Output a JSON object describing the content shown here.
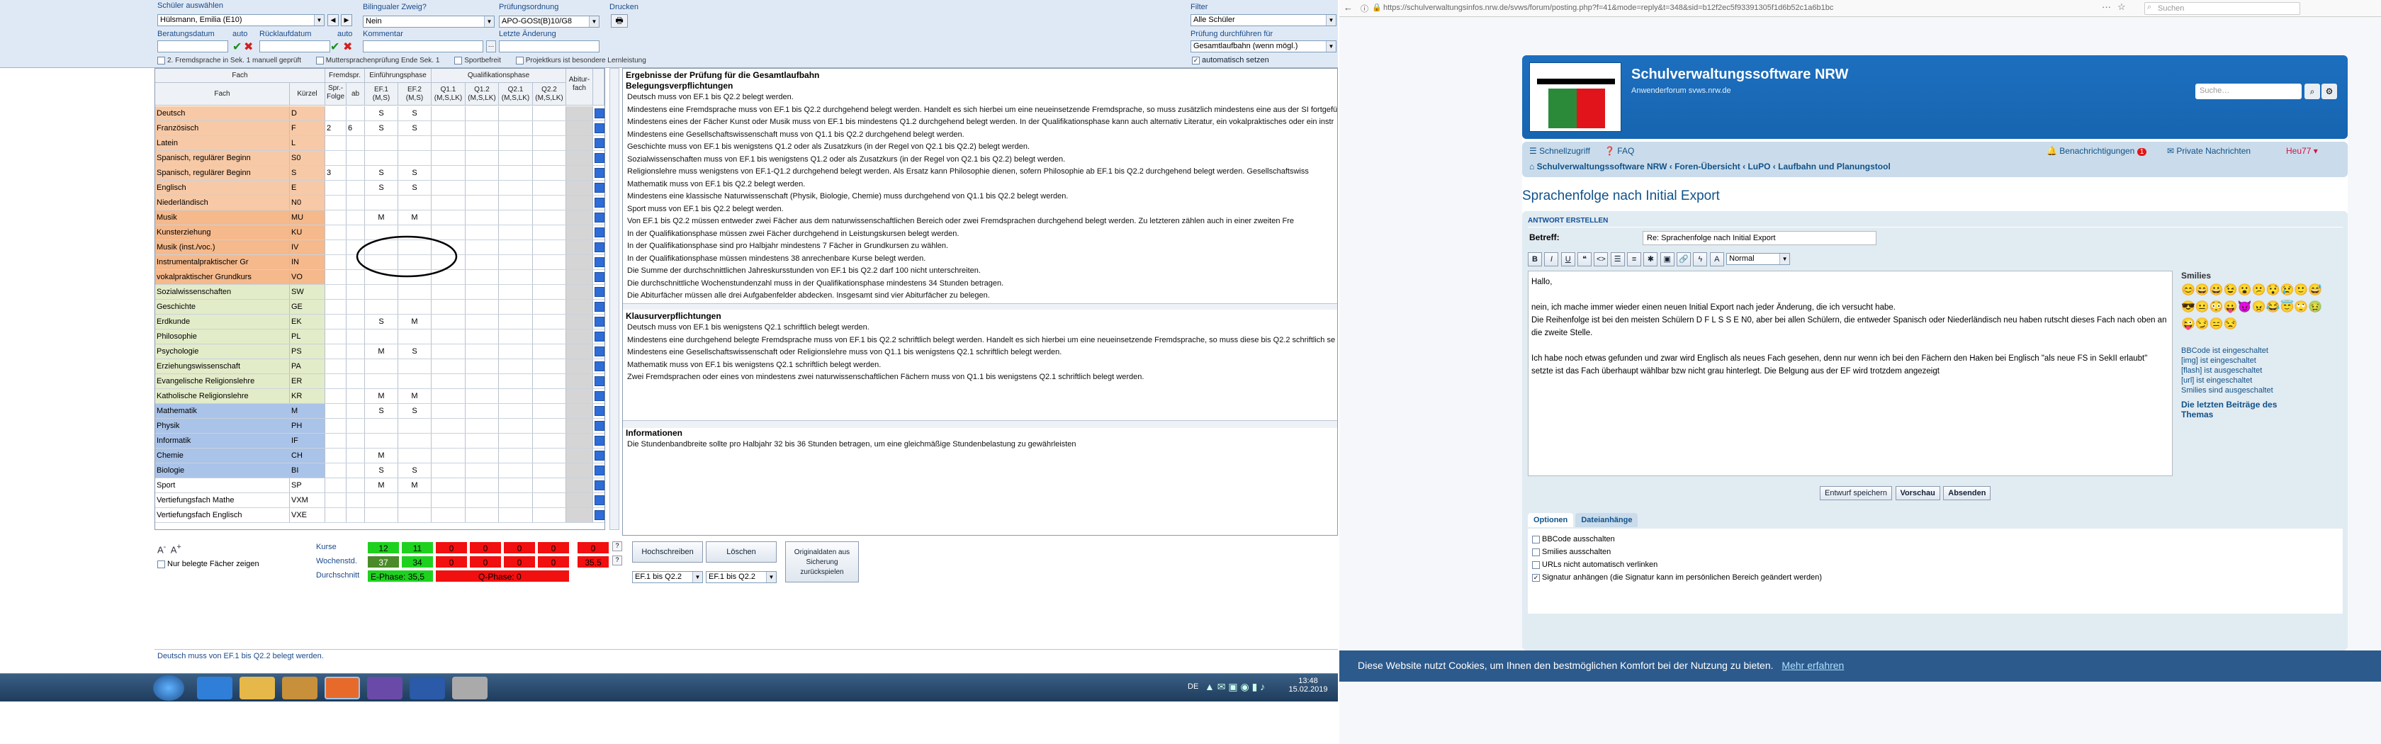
{
  "left": {
    "schueler": {
      "label": "Schüler auswählen",
      "value": "Hülsmann, Emilia (E10)"
    },
    "bili": {
      "label": "Bilingualer Zweig?",
      "value": "Nein"
    },
    "pruefo": {
      "label": "Prüfungsordnung",
      "value": "APO-GOSt(B)10/G8"
    },
    "drucken": {
      "label": "Drucken"
    },
    "beratungsdatum": "Beratungsdatum",
    "auto1": "auto",
    "rueckl": "Rücklaufdatum",
    "auto2": "auto",
    "kommentar": "Kommentar",
    "letzte": "Letzte Änderung",
    "filter": {
      "label": "Filter",
      "value": "Alle Schüler"
    },
    "pruefung": {
      "label": "Prüfung durchführen für",
      "value": "Gesamtlaufbahn (wenn mögl.)",
      "auto": "automatisch setzen"
    },
    "checks": [
      "2. Fremdsprache in Sek. 1 manuell geprüft",
      "Muttersprachenprüfung Ende Sek. 1",
      "Sportbefreit",
      "Projektkurs ist besondere Lernleistung"
    ],
    "grid": {
      "headers": {
        "fach": "Fach",
        "fremdsp": "Fremdspr.",
        "einf": "Einführungsphase",
        "quali": "Qualifikationsphase",
        "abi": "Abitur-fach",
        "fach2": "Fach",
        "kuerzel": "Kürzel",
        "spr": "Spr.-Folge",
        "abjg": "ab Jg.",
        "ef1": "EF.1 (M,S)",
        "ef2": "EF.2 (M,S)",
        "q11": "Q1.1 (M,S,LK)",
        "q12": "Q1.2 (M,S,LK)",
        "q21": "Q2.1 (M,S,LK)",
        "q22": "Q2.2 (M,S,LK)"
      },
      "rows": [
        {
          "name": "Deutsch",
          "k": "D",
          "sf": "",
          "jg": "",
          "e1": "S",
          "e2": "S",
          "color": "#f7c9a6"
        },
        {
          "name": "Französisch",
          "k": "F",
          "sf": "2",
          "jg": "6",
          "e1": "S",
          "e2": "S",
          "color": "#f7c9a6"
        },
        {
          "name": "Latein",
          "k": "L",
          "sf": "",
          "jg": "",
          "e1": "",
          "e2": "",
          "color": "#f7c9a6"
        },
        {
          "name": "Spanisch, regulärer Beginn",
          "k": "S0",
          "sf": "",
          "jg": "",
          "e1": "",
          "e2": "",
          "color": "#f7c9a6"
        },
        {
          "name": "Spanisch, regulärer Beginn",
          "k": "S",
          "sf": "3",
          "jg": "",
          "e1": "S",
          "e2": "S",
          "color": "#f7c9a6"
        },
        {
          "name": "Englisch",
          "k": "E",
          "sf": "",
          "jg": "",
          "e1": "S",
          "e2": "S",
          "color": "#f7c9a6"
        },
        {
          "name": "Niederländisch",
          "k": "N0",
          "sf": "",
          "jg": "",
          "e1": "",
          "e2": "",
          "color": "#f7c9a6"
        },
        {
          "name": "Musik",
          "k": "MU",
          "sf": "",
          "jg": "",
          "e1": "M",
          "e2": "M",
          "color": "#f5b98c"
        },
        {
          "name": "Kunsterziehung",
          "k": "KU",
          "sf": "",
          "jg": "",
          "e1": "",
          "e2": "",
          "color": "#f5b98c"
        },
        {
          "name": "Musik (inst./voc.)",
          "k": "IV",
          "sf": "",
          "jg": "",
          "e1": "",
          "e2": "",
          "color": "#f5b98c"
        },
        {
          "name": "Instrumentalpraktischer Gr",
          "k": "IN",
          "sf": "",
          "jg": "",
          "e1": "",
          "e2": "",
          "color": "#f5b98c"
        },
        {
          "name": "vokalpraktischer Grundkurs",
          "k": "VO",
          "sf": "",
          "jg": "",
          "e1": "",
          "e2": "",
          "color": "#f5b98c"
        },
        {
          "name": "Sozialwissenschaften",
          "k": "SW",
          "sf": "",
          "jg": "",
          "e1": "",
          "e2": "",
          "color": "#e3ecc9"
        },
        {
          "name": "Geschichte",
          "k": "GE",
          "sf": "",
          "jg": "",
          "e1": "",
          "e2": "",
          "color": "#e3ecc9"
        },
        {
          "name": "Erdkunde",
          "k": "EK",
          "sf": "",
          "jg": "",
          "e1": "S",
          "e2": "M",
          "color": "#e3ecc9"
        },
        {
          "name": "Philosophie",
          "k": "PL",
          "sf": "",
          "jg": "",
          "e1": "",
          "e2": "",
          "color": "#e3ecc9"
        },
        {
          "name": "Psychologie",
          "k": "PS",
          "sf": "",
          "jg": "",
          "e1": "M",
          "e2": "S",
          "color": "#e3ecc9"
        },
        {
          "name": "Erziehungswissenschaft",
          "k": "PA",
          "sf": "",
          "jg": "",
          "e1": "",
          "e2": "",
          "color": "#e3ecc9"
        },
        {
          "name": "Evangelische Religionslehre",
          "k": "ER",
          "sf": "",
          "jg": "",
          "e1": "",
          "e2": "",
          "color": "#e3ecc9"
        },
        {
          "name": "Katholische Religionslehre",
          "k": "KR",
          "sf": "",
          "jg": "",
          "e1": "M",
          "e2": "M",
          "color": "#e3ecc9"
        },
        {
          "name": "Mathematik",
          "k": "M",
          "sf": "",
          "jg": "",
          "e1": "S",
          "e2": "S",
          "color": "#aac3e8"
        },
        {
          "name": "Physik",
          "k": "PH",
          "sf": "",
          "jg": "",
          "e1": "",
          "e2": "",
          "color": "#aac3e8"
        },
        {
          "name": "Informatik",
          "k": "IF",
          "sf": "",
          "jg": "",
          "e1": "",
          "e2": "",
          "color": "#aac3e8"
        },
        {
          "name": "Chemie",
          "k": "CH",
          "sf": "",
          "jg": "",
          "e1": "M",
          "e2": "",
          "color": "#aac3e8"
        },
        {
          "name": "Biologie",
          "k": "BI",
          "sf": "",
          "jg": "",
          "e1": "S",
          "e2": "S",
          "color": "#aac3e8"
        },
        {
          "name": "Sport",
          "k": "SP",
          "sf": "",
          "jg": "",
          "e1": "M",
          "e2": "M",
          "color": "#ffffff"
        },
        {
          "name": "Vertiefungsfach Mathe",
          "k": "VXM",
          "sf": "",
          "jg": "",
          "e1": "",
          "e2": "",
          "color": "#ffffff"
        },
        {
          "name": "Vertiefungsfach Englisch",
          "k": "VXE",
          "sf": "",
          "jg": "",
          "e1": "",
          "e2": "",
          "color": "#ffffff"
        }
      ]
    },
    "results": {
      "title": "Ergebnisse der Prüfung für die Gesamtlaufbahn",
      "beleg_title": "Belegungsverpflichtungen",
      "beleg": [
        "Deutsch muss von EF.1 bis Q2.2 belegt werden.",
        "Mindestens eine Fremdsprache muss von EF.1 bis Q2.2 durchgehend belegt werden. Handelt es sich hierbei um eine neueinsetzende Fremdsprache, so muss zusätzlich mindestens eine aus der SI fortgeführt",
        "Mindestens eines der Fächer Kunst oder Musik muss von EF.1 bis mindestens Q1.2 durchgehend belegt werden. In der Qualifikationsphase kann auch alternativ Literatur, ein vokalpraktisches oder ein instr",
        "Mindestens eine Gesellschaftswissenschaft muss von Q1.1 bis Q2.2 durchgehend belegt werden.",
        "Geschichte muss von EF.1 bis wenigstens Q1.2 oder als Zusatzkurs (in der Regel von Q2.1 bis Q2.2) belegt werden.",
        "Sozialwissenschaften muss von EF.1 bis wenigstens Q1.2 oder als Zusatzkurs (in der Regel von Q2.1 bis Q2.2) belegt werden.",
        "Religionslehre muss wenigstens von EF.1-Q1.2 durchgehend belegt werden. Als Ersatz kann Philosophie dienen, sofern Philosophie ab EF.1 bis Q2.2 durchgehend belegt werden. Gesellschaftswiss",
        "Mathematik muss von EF.1 bis Q2.2 belegt werden.",
        "Mindestens eine klassische Naturwissenschaft (Physik, Biologie, Chemie) muss durchgehend von Q1.1 bis Q2.2 belegt werden.",
        "Sport muss von EF.1 bis Q2.2 belegt werden.",
        "Von EF.1 bis Q2.2 müssen entweder zwei Fächer aus dem naturwissenschaftlichen Bereich oder zwei Fremdsprachen durchgehend belegt werden. Zu letzteren zählen auch in einer zweiten Fre",
        "In der Qualifikationsphase müssen zwei Fächer durchgehend in Leistungskursen belegt werden.",
        "In der Qualifikationsphase sind pro Halbjahr mindestens 7 Fächer in Grundkursen zu wählen.",
        "In der Qualifikationsphase müssen mindestens 38 anrechenbare Kurse belegt werden.",
        "Die Summe der durchschnittlichen Jahreskursstunden von EF.1 bis Q2.2 darf 100 nicht unterschreiten.",
        "Die durchschnittliche Wochenstundenzahl muss in der Qualifikationsphase mindestens 34 Stunden betragen.",
        "Die Abiturfächer müssen alle drei Aufgabenfelder abdecken. Insgesamt sind vier Abiturfächer zu belegen."
      ],
      "klaus_title": "Klausurverpflichtungen",
      "klaus": [
        "Deutsch muss von EF.1 bis wenigstens Q2.1 schriftlich belegt werden.",
        "Mindestens eine durchgehend belegte Fremdsprache muss von EF.1 bis Q2.2 schriftlich belegt werden. Handelt es sich hierbei um eine neueinsetzende Fremdsprache, so muss diese bis Q2.2 schriftlich se",
        "Mindestens eine Gesellschaftswissenschaft oder Religionslehre muss von Q1.1 bis wenigstens Q2.1 schriftlich belegt werden.",
        "Mathematik muss von EF.1 bis wenigstens Q2.1 schriftlich belegt werden.",
        "Zwei Fremdsprachen oder eines von mindestens zwei naturwissenschaftlichen Fächern muss von Q1.1 bis wenigstens Q2.1 schriftlich belegt werden."
      ],
      "info_title": "Informationen",
      "info": [
        "Die Stundenbandbreite sollte pro Halbjahr 32 bis 36 Stunden betragen, um eine gleichmäßige Stundenbelastung zu gewährleisten"
      ]
    },
    "summary": {
      "nur": "Nur belegte Fächer zeigen",
      "kurse": "Kurse",
      "wochen": "Wochenstd.",
      "durch": "Durchschnitt",
      "k1": "12",
      "k2": "11",
      "w1": "37",
      "w2": "34",
      "zeros": "0",
      "w_sum": "35,5",
      "ephase": "E-Phase: 35,5",
      "qphase": "Q-Phase: 0",
      "hoch": "Hochschreiben",
      "loesch": "Löschen",
      "orig": "Originaldaten aus Sicherung zurückspielen",
      "sel1": "EF.1 bis Q2.2",
      "sel2": "EF.1 bis Q2.2",
      "q": "?"
    },
    "status": "Deutsch muss von EF.1 bis Q2.2 belegt werden.",
    "clock": {
      "time": "13:48",
      "date": "15.02.2019",
      "lang": "DE"
    }
  },
  "browser": {
    "url": "https://schulverwaltungsinfos.nrw.de/svws/forum/posting.php?f=41&mode=reply&t=348&sid=b12f2ec5f93391305f1d6b52c1a6b1bc",
    "search": "Suchen",
    "site_title": "Schulverwaltungssoftware NRW",
    "site_sub": "Anwenderforum svws.nrw.de",
    "site_search": "Suche…",
    "nav_quick": "Schnellzugriff",
    "nav_faq": "FAQ",
    "notif": "Benachrichtigungen",
    "notif_count": "1",
    "pm": "Private Nachrichten",
    "user": "Heu77",
    "crumb": [
      "Schulverwaltungssoftware NRW",
      "Foren-Übersicht",
      "LuPO",
      "Laufbahn und Planungstool"
    ],
    "topic": "Sprachenfolge nach Initial Export",
    "answer": "ANTWORT ERSTELLEN",
    "betreff_label": "Betreff:",
    "betreff": "Re: Sprachenfolge nach Initial Export",
    "fontsel": "Normal",
    "body": [
      "Hallo,",
      "",
      "nein, ich mache immer wieder einen neuen Initial Export nach jeder Änderung, die ich versucht habe.",
      "Die Reihenfolge ist bei den meisten Schülern D F L S S E N0, aber bei allen Schülern, die entweder Spanisch oder Niederländisch neu haben rutscht dieses Fach nach oben an die zweite Stelle.",
      "",
      "Ich habe noch etwas gefunden und zwar wird Englisch als neues Fach gesehen, denn nur wenn ich bei den Fächern den Haken bei Englisch \"als neue FS in SekII erlaubt\" setzte ist das Fach überhaupt wählbar bzw nicht grau hinterlegt. Die Belgung aus der EF wird trotzdem angezeigt"
    ],
    "smilies": "Smilies",
    "side_info": [
      "BBCode ist eingeschaltet",
      "[img] ist eingeschaltet",
      "[flash] ist ausgeschaltet",
      "[url] ist eingeschaltet",
      "Smilies sind ausgeschaltet"
    ],
    "letzte": "Die letzten Beiträge des Themas",
    "btn_draft": "Entwurf speichern",
    "btn_preview": "Vorschau",
    "btn_send": "Absenden",
    "tab_opt": "Optionen",
    "tab_att": "Dateianhänge",
    "opts": [
      "BBCode ausschalten",
      "Smilies ausschalten",
      "URLs nicht automatisch verlinken",
      "Signatur anhängen (die Signatur kann im persönlichen Bereich geändert werden)"
    ],
    "cookie": "Diese Website nutzt Cookies, um Ihnen den bestmöglichen Komfort bei der Nutzung zu bieten.",
    "cookie_link": "Mehr erfahren"
  },
  "colors": {
    "accent": "#1a4a8a",
    "cookie": "#2c5a8c",
    "green": "#1fd11f",
    "red": "#f20f0f"
  }
}
